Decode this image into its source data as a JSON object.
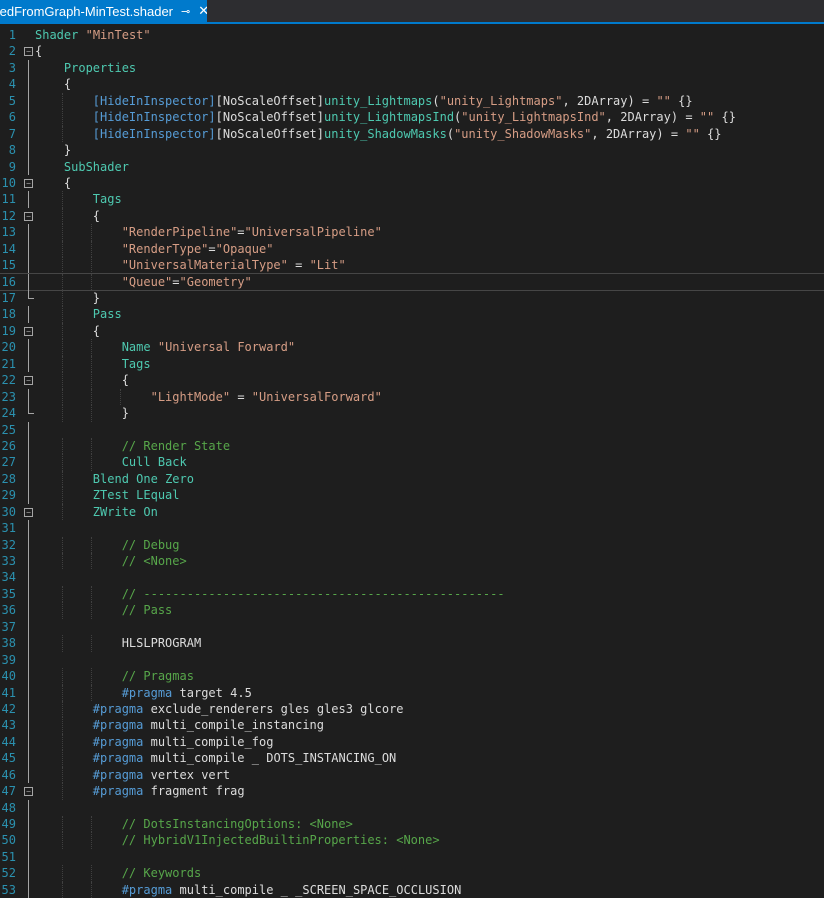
{
  "tab": {
    "title": "tedFromGraph-MinTest.shader",
    "pin": "⊸",
    "close": "✕"
  },
  "colors": {
    "accent": "#007acc",
    "background": "#1e1e1e",
    "line_number": "#2b91af"
  },
  "lines": [
    {
      "n": "1",
      "fold": "",
      "text": "Shader \"MinTest\""
    },
    {
      "n": "2",
      "fold": "minus",
      "text": "{"
    },
    {
      "n": "3",
      "fold": "",
      "text": "    Properties"
    },
    {
      "n": "4",
      "fold": "",
      "text": "    {"
    },
    {
      "n": "5",
      "fold": "",
      "text": "        [HideInInspector][NoScaleOffset]unity_Lightmaps(\"unity_Lightmaps\", 2DArray) = \"\" {}"
    },
    {
      "n": "6",
      "fold": "",
      "text": "        [HideInInspector][NoScaleOffset]unity_LightmapsInd(\"unity_LightmapsInd\", 2DArray) = \"\" {}"
    },
    {
      "n": "7",
      "fold": "",
      "text": "        [HideInInspector][NoScaleOffset]unity_ShadowMasks(\"unity_ShadowMasks\", 2DArray) = \"\" {}"
    },
    {
      "n": "8",
      "fold": "",
      "text": "    }"
    },
    {
      "n": "9",
      "fold": "",
      "text": "    SubShader"
    },
    {
      "n": "10",
      "fold": "minus",
      "text": "    {"
    },
    {
      "n": "11",
      "fold": "",
      "text": "        Tags"
    },
    {
      "n": "12",
      "fold": "minus",
      "text": "        {"
    },
    {
      "n": "13",
      "fold": "",
      "text": "            \"RenderPipeline\"=\"UniversalPipeline\""
    },
    {
      "n": "14",
      "fold": "",
      "text": "            \"RenderType\"=\"Opaque\""
    },
    {
      "n": "15",
      "fold": "",
      "text": "            \"UniversalMaterialType\" = \"Lit\""
    },
    {
      "n": "16",
      "fold": "",
      "text": "            \"Queue\"=\"Geometry\""
    },
    {
      "n": "17",
      "fold": "end",
      "text": "        }"
    },
    {
      "n": "18",
      "fold": "",
      "text": "        Pass"
    },
    {
      "n": "19",
      "fold": "minus",
      "text": "        {"
    },
    {
      "n": "20",
      "fold": "",
      "text": "            Name \"Universal Forward\""
    },
    {
      "n": "21",
      "fold": "",
      "text": "            Tags"
    },
    {
      "n": "22",
      "fold": "minus",
      "text": "            {"
    },
    {
      "n": "23",
      "fold": "",
      "text": "                \"LightMode\" = \"UniversalForward\""
    },
    {
      "n": "24",
      "fold": "end",
      "text": "            }"
    },
    {
      "n": "25",
      "fold": "",
      "text": ""
    },
    {
      "n": "26",
      "fold": "",
      "text": "            // Render State"
    },
    {
      "n": "27",
      "fold": "",
      "text": "            Cull Back"
    },
    {
      "n": "28",
      "fold": "",
      "text": "        Blend One Zero"
    },
    {
      "n": "29",
      "fold": "",
      "text": "        ZTest LEqual"
    },
    {
      "n": "30",
      "fold": "minus",
      "text": "        ZWrite On"
    },
    {
      "n": "31",
      "fold": "",
      "text": ""
    },
    {
      "n": "32",
      "fold": "",
      "text": "            // Debug"
    },
    {
      "n": "33",
      "fold": "",
      "text": "            // <None>"
    },
    {
      "n": "34",
      "fold": "",
      "text": ""
    },
    {
      "n": "35",
      "fold": "",
      "text": "            // --------------------------------------------------"
    },
    {
      "n": "36",
      "fold": "",
      "text": "            // Pass"
    },
    {
      "n": "37",
      "fold": "",
      "text": ""
    },
    {
      "n": "38",
      "fold": "",
      "text": "            HLSLPROGRAM"
    },
    {
      "n": "39",
      "fold": "",
      "text": ""
    },
    {
      "n": "40",
      "fold": "",
      "text": "            // Pragmas"
    },
    {
      "n": "41",
      "fold": "",
      "text": "            #pragma target 4.5"
    },
    {
      "n": "42",
      "fold": "",
      "text": "        #pragma exclude_renderers gles gles3 glcore"
    },
    {
      "n": "43",
      "fold": "",
      "text": "        #pragma multi_compile_instancing"
    },
    {
      "n": "44",
      "fold": "",
      "text": "        #pragma multi_compile_fog"
    },
    {
      "n": "45",
      "fold": "",
      "text": "        #pragma multi_compile _ DOTS_INSTANCING_ON"
    },
    {
      "n": "46",
      "fold": "",
      "text": "        #pragma vertex vert"
    },
    {
      "n": "47",
      "fold": "minus",
      "text": "        #pragma fragment frag"
    },
    {
      "n": "48",
      "fold": "",
      "text": ""
    },
    {
      "n": "49",
      "fold": "",
      "text": "            // DotsInstancingOptions: <None>"
    },
    {
      "n": "50",
      "fold": "",
      "text": "            // HybridV1InjectedBuiltinProperties: <None>"
    },
    {
      "n": "51",
      "fold": "",
      "text": ""
    },
    {
      "n": "52",
      "fold": "",
      "text": "            // Keywords"
    },
    {
      "n": "53",
      "fold": "",
      "text": "            #pragma multi_compile _ _SCREEN_SPACE_OCCLUSION"
    }
  ],
  "current_line": "16"
}
